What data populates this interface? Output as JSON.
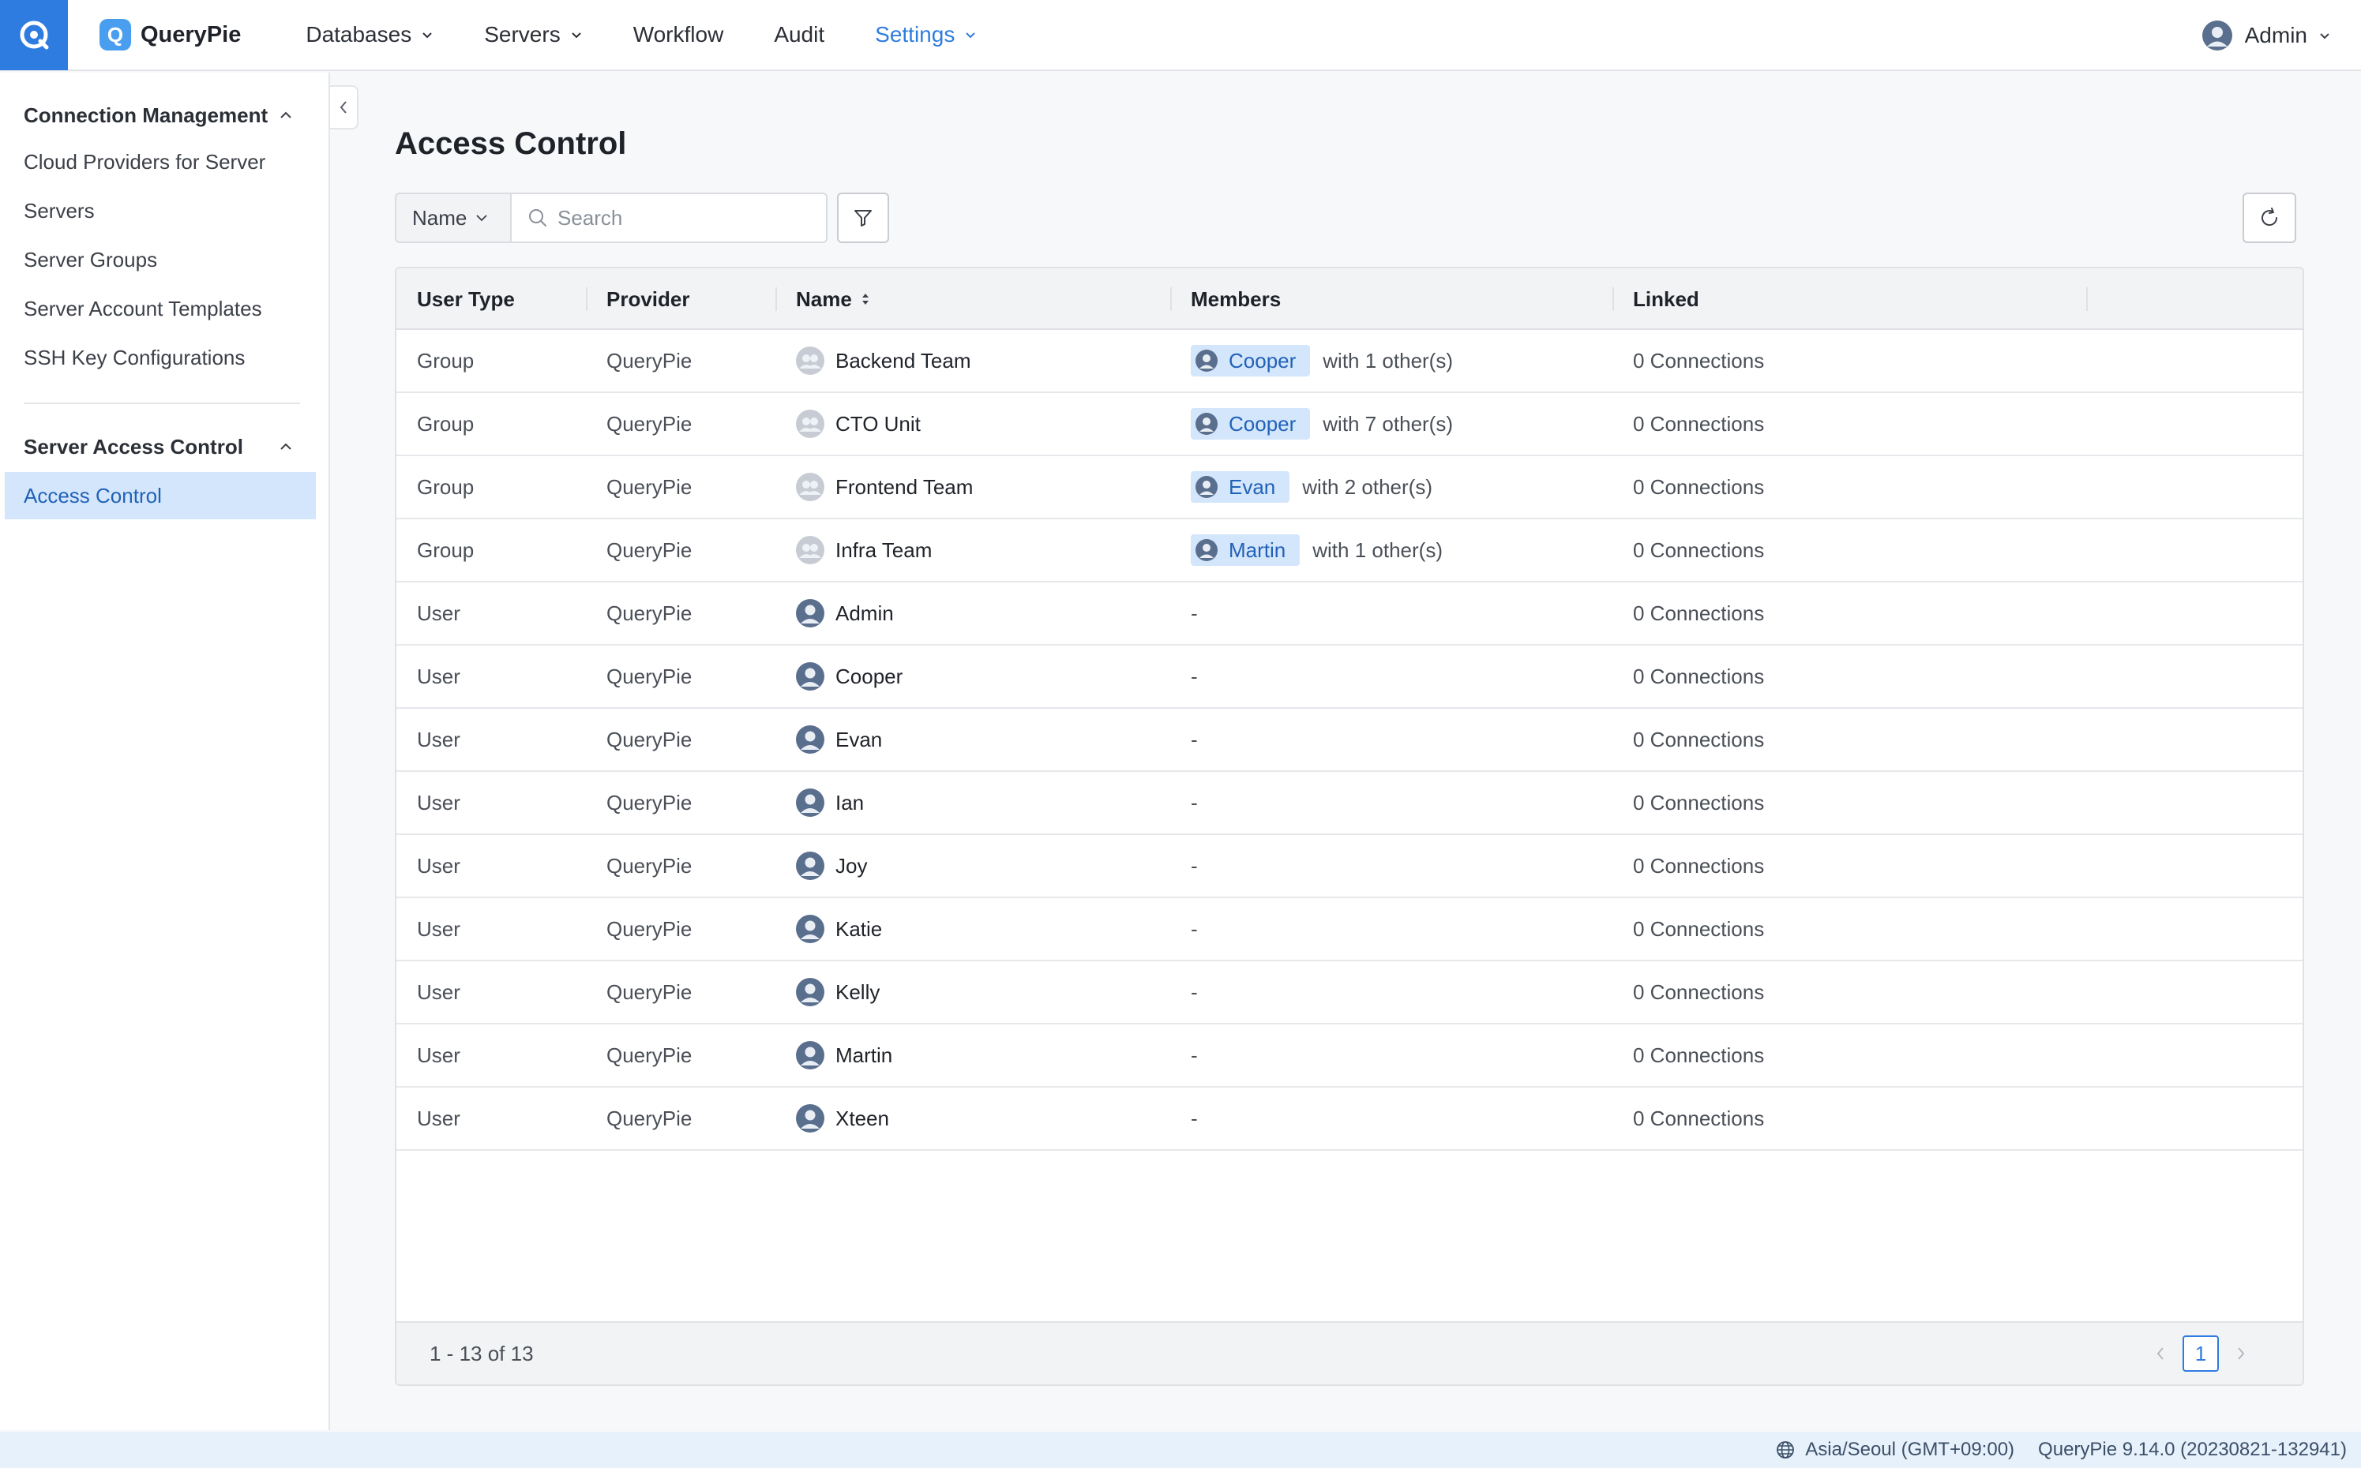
{
  "brand": {
    "name": "QueryPie",
    "logo_letter": "Q"
  },
  "nav": {
    "items": [
      {
        "label": "Databases",
        "has_dropdown": true,
        "active": false
      },
      {
        "label": "Servers",
        "has_dropdown": true,
        "active": false
      },
      {
        "label": "Workflow",
        "has_dropdown": false,
        "active": false
      },
      {
        "label": "Audit",
        "has_dropdown": false,
        "active": false
      },
      {
        "label": "Settings",
        "has_dropdown": true,
        "active": true
      }
    ],
    "user": "Admin"
  },
  "sidebar": {
    "sections": [
      {
        "title": "Connection Management",
        "items": [
          "Cloud Providers for Server",
          "Servers",
          "Server Groups",
          "Server Account Templates",
          "SSH Key Configurations"
        ]
      },
      {
        "title": "Server Access Control",
        "items": [
          "Access Control"
        ]
      }
    ],
    "selected": "Access Control"
  },
  "page": {
    "title": "Access Control",
    "search": {
      "field": "Name",
      "placeholder": "Search"
    }
  },
  "table": {
    "columns": [
      "User Type",
      "Provider",
      "Name",
      "Members",
      "Linked"
    ],
    "rows": [
      {
        "user_type": "Group",
        "provider": "QueryPie",
        "name": "Backend Team",
        "member": "Cooper",
        "member_extra": "with 1 other(s)",
        "linked": "0 Connections"
      },
      {
        "user_type": "Group",
        "provider": "QueryPie",
        "name": "CTO Unit",
        "member": "Cooper",
        "member_extra": "with 7 other(s)",
        "linked": "0 Connections"
      },
      {
        "user_type": "Group",
        "provider": "QueryPie",
        "name": "Frontend Team",
        "member": "Evan",
        "member_extra": "with 2 other(s)",
        "linked": "0 Connections"
      },
      {
        "user_type": "Group",
        "provider": "QueryPie",
        "name": "Infra Team",
        "member": "Martin",
        "member_extra": "with 1 other(s)",
        "linked": "0 Connections"
      },
      {
        "user_type": "User",
        "provider": "QueryPie",
        "name": "Admin",
        "member_text": "-",
        "linked": "0 Connections"
      },
      {
        "user_type": "User",
        "provider": "QueryPie",
        "name": "Cooper",
        "member_text": "-",
        "linked": "0 Connections"
      },
      {
        "user_type": "User",
        "provider": "QueryPie",
        "name": "Evan",
        "member_text": "-",
        "linked": "0 Connections"
      },
      {
        "user_type": "User",
        "provider": "QueryPie",
        "name": "Ian",
        "member_text": "-",
        "linked": "0 Connections"
      },
      {
        "user_type": "User",
        "provider": "QueryPie",
        "name": "Joy",
        "member_text": "-",
        "linked": "0 Connections"
      },
      {
        "user_type": "User",
        "provider": "QueryPie",
        "name": "Katie",
        "member_text": "-",
        "linked": "0 Connections"
      },
      {
        "user_type": "User",
        "provider": "QueryPie",
        "name": "Kelly",
        "member_text": "-",
        "linked": "0 Connections"
      },
      {
        "user_type": "User",
        "provider": "QueryPie",
        "name": "Martin",
        "member_text": "-",
        "linked": "0 Connections"
      },
      {
        "user_type": "User",
        "provider": "QueryPie",
        "name": "Xteen",
        "member_text": "-",
        "linked": "0 Connections"
      }
    ],
    "range_text": "1 - 13 of 13",
    "current_page": "1"
  },
  "status": {
    "timezone": "Asia/Seoul (GMT+09:00)",
    "version": "QueryPie 9.14.0 (20230821-132941)"
  },
  "colors": {
    "accent": "#2f7ce0",
    "chip_bg": "#d4e6fb",
    "chip_text": "#2162b8",
    "header_bg": "#f2f3f5",
    "status_bg": "#e7f1fb"
  }
}
